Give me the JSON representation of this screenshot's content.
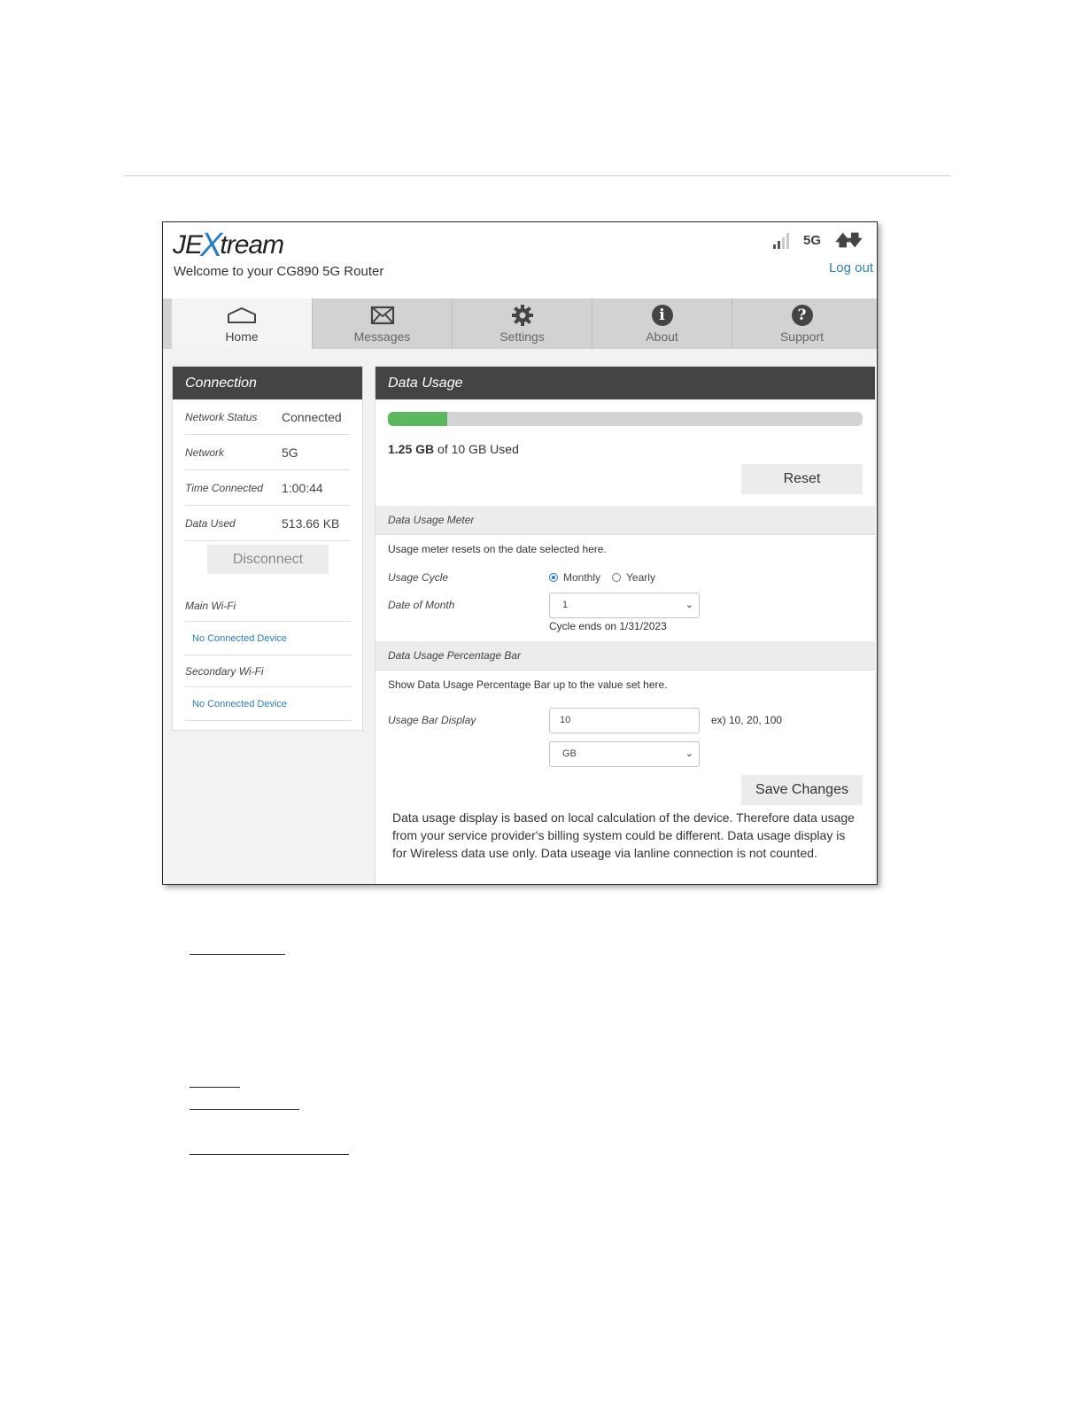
{
  "header": {
    "logo_left": "JE",
    "logo_x": "X",
    "logo_right": "tream",
    "welcome": "Welcome to your CG890 5G Router",
    "network_type": "5G",
    "transfer_icon": "up-down-arrows-icon",
    "logout": "Log out"
  },
  "nav": {
    "tabs": [
      {
        "label": "Home",
        "icon": "home-icon",
        "active": true
      },
      {
        "label": "Messages",
        "icon": "envelope-icon"
      },
      {
        "label": "Settings",
        "icon": "gear-icon"
      },
      {
        "label": "About",
        "icon": "info-icon",
        "glyph": "i"
      },
      {
        "label": "Support",
        "icon": "help-icon",
        "glyph": "?"
      }
    ]
  },
  "connection": {
    "title": "Connection",
    "rows": [
      {
        "label": "Network Status",
        "value": "Connected"
      },
      {
        "label": "Network",
        "value": "5G"
      },
      {
        "label": "Time Connected",
        "value": "1:00:44"
      },
      {
        "label": "Data Used",
        "value": "513.66 KB"
      }
    ],
    "disconnect_label": "Disconnect",
    "main_wifi_label": "Main Wi-Fi",
    "main_wifi_device": "No Connected Device",
    "secondary_wifi_label": "Secondary Wi-Fi",
    "secondary_wifi_device": "No Connected Device"
  },
  "usage": {
    "title": "Data Usage",
    "used_percent": 12.5,
    "used_amount": "1.25 GB",
    "used_suffix": " of 10 GB Used",
    "reset_label": "Reset",
    "meter_section": "Data Usage Meter",
    "meter_desc": "Usage meter resets on the date selected here.",
    "cycle_label": "Usage Cycle",
    "cycle_monthly": "Monthly",
    "cycle_yearly": "Yearly",
    "date_label": "Date of Month",
    "date_value": "1",
    "cycle_ends": "Cycle ends on 1/31/2023",
    "bar_section": "Data Usage Percentage Bar",
    "bar_desc": "Show Data Usage Percentage Bar up to the value set here.",
    "bar_display_label": "Usage Bar Display",
    "bar_display_value": "10",
    "bar_display_hint": "ex) 10, 20, 100",
    "unit_value": "GB",
    "save_label": "Save Changes",
    "note": "Data usage display is based on local calculation of the device. Therefore data usage from your service provider's billing system could be different. Data usage display is for Wireless data use only. Data useage via lanline connection is not counted."
  },
  "colors": {
    "accent": "#2a7fc1",
    "usage_fill": "#5cb85c",
    "panel_header": "#444444"
  }
}
